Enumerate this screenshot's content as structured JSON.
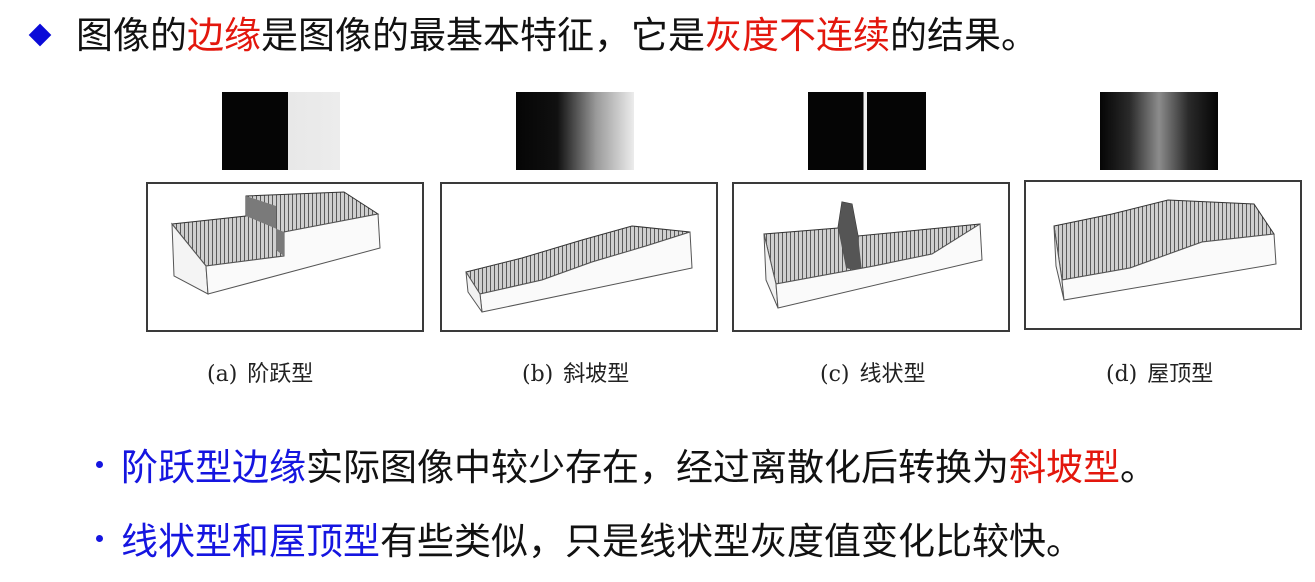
{
  "title": {
    "parts": [
      "图像的",
      "边缘",
      "是图像的最基本特征，它是",
      "灰度不连续",
      "的结果。"
    ]
  },
  "figure": {
    "captions": [
      {
        "letter": "(a)",
        "name": "阶跃型"
      },
      {
        "letter": "(b)",
        "name": "斜坡型"
      },
      {
        "letter": "(c)",
        "name": "线状型"
      },
      {
        "letter": "(d)",
        "name": "屋顶型"
      }
    ]
  },
  "bullets": [
    {
      "parts": [
        "阶跃型边缘",
        "实际图像中较少存在，经过离散化后转换为",
        "斜坡型",
        "。"
      ]
    },
    {
      "parts": [
        "线状型和屋顶型",
        "有些类似，只是线状型灰度值变化比较快。"
      ]
    }
  ],
  "colors": {
    "emphasis_red": "#e3170d",
    "emphasis_blue": "#1515e0",
    "bullet_diamond": "#0b0bd8"
  }
}
